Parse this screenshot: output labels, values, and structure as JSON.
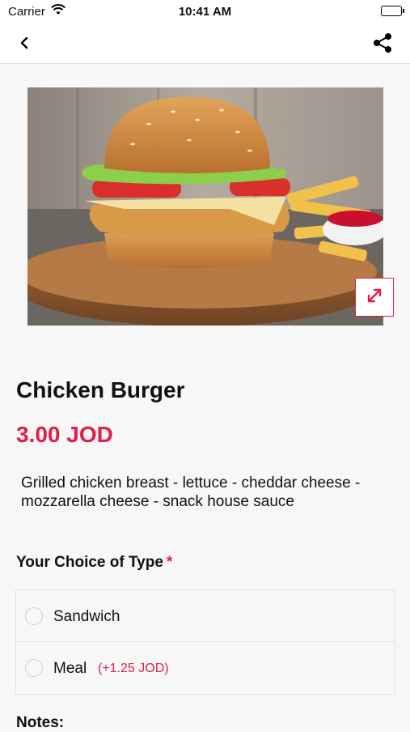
{
  "status_bar": {
    "carrier": "Carrier",
    "time": "10:41 AM"
  },
  "nav": {
    "back_icon": "back-chevron-icon",
    "share_icon": "share-icon"
  },
  "product": {
    "name": "Chicken Burger",
    "price": "3.00 JOD",
    "description": "Grilled chicken breast - lettuce - cheddar cheese - mozzarella cheese - snack house sauce",
    "image": "chicken-burger-photo",
    "expand_icon": "expand-icon"
  },
  "type_section": {
    "title": "Your Choice of Type",
    "required_mark": "*",
    "options": [
      {
        "label": "Sandwich",
        "extra": ""
      },
      {
        "label": "Meal",
        "extra": "(+1.25 JOD)"
      }
    ]
  },
  "notes": {
    "title": "Notes:"
  },
  "colors": {
    "accent": "#e11d48",
    "background": "#f7f7f7"
  }
}
